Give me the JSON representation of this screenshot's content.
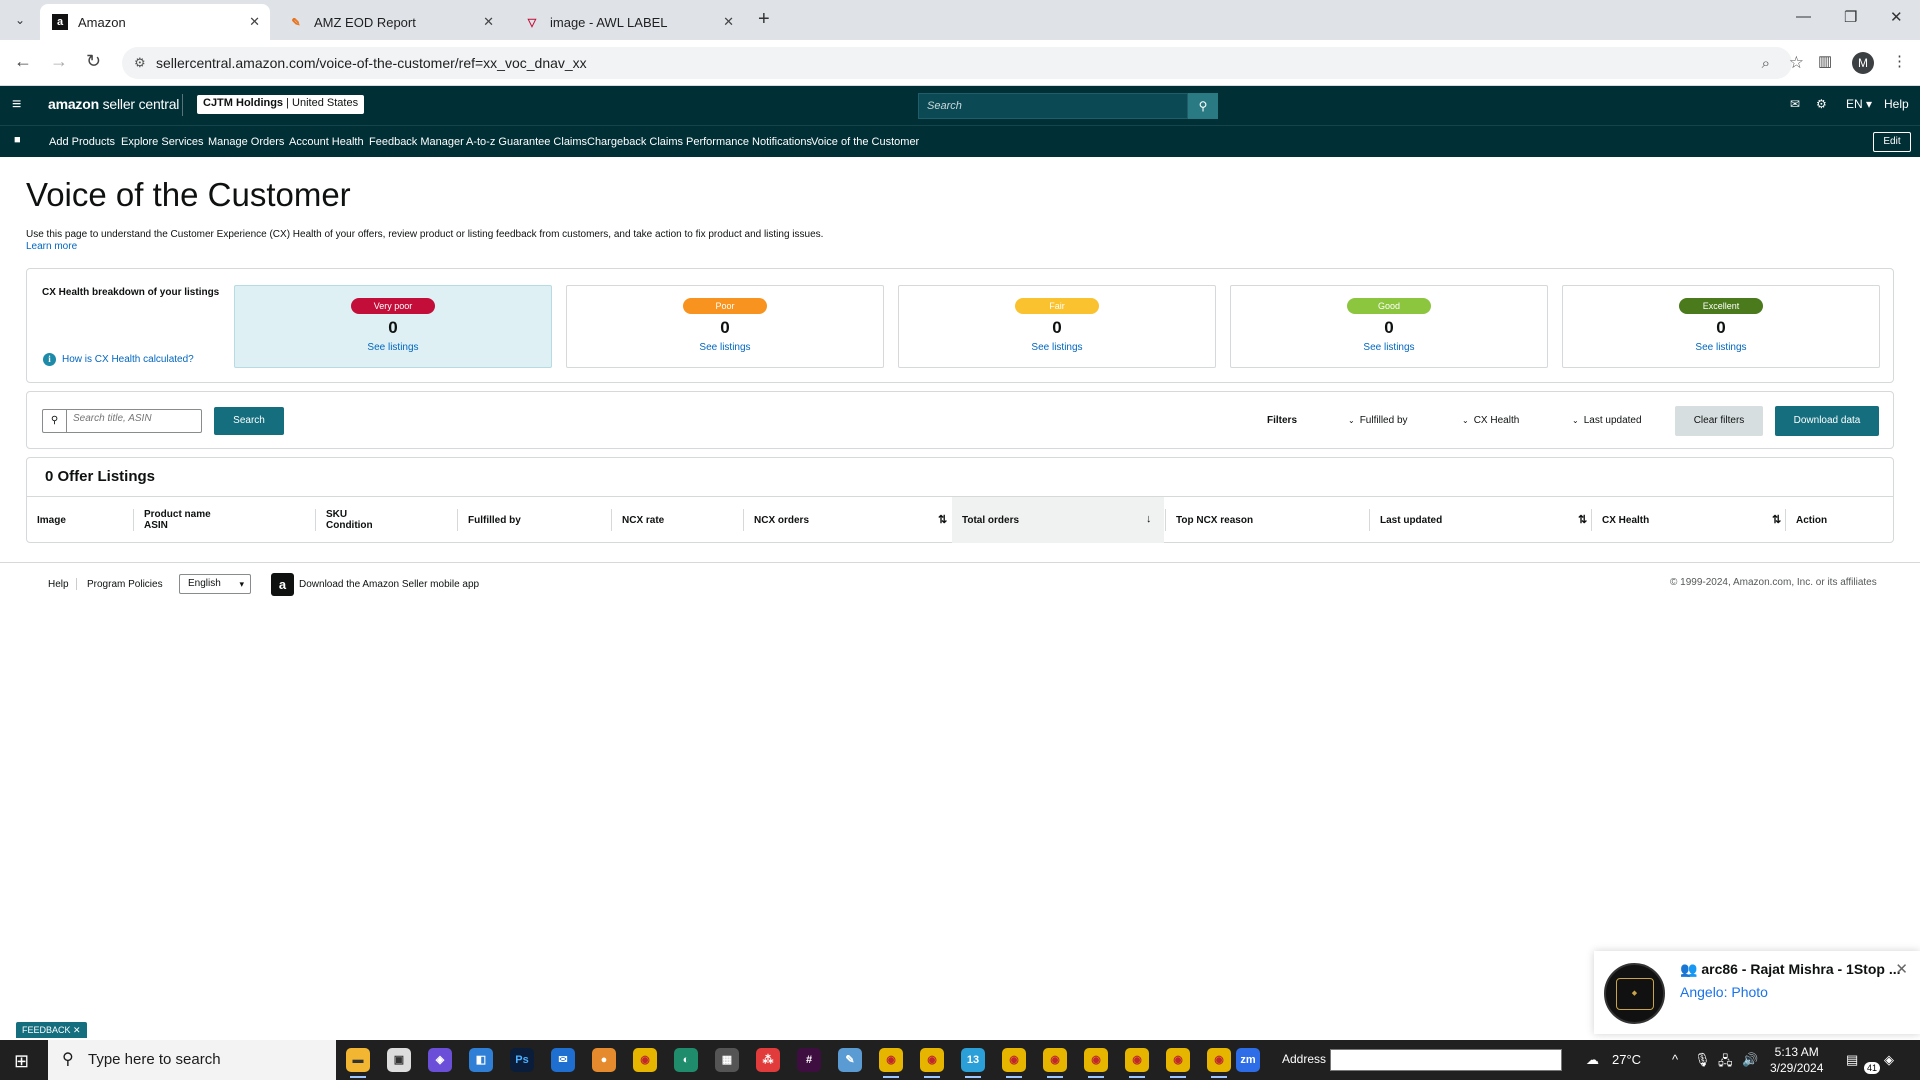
{
  "browser": {
    "tabs": [
      {
        "title": "Amazon",
        "favicon": "a",
        "active": true
      },
      {
        "title": "AMZ EOD Report",
        "favicon": "✎",
        "active": false
      },
      {
        "title": "image - AWL LABEL",
        "favicon": "▽",
        "active": false
      }
    ],
    "url": "sellercentral.amazon.com/voice-of-the-customer/ref=xx_voc_dnav_xx",
    "profile_initial": "M"
  },
  "header": {
    "logo_bold": "amazon",
    "logo_light": " seller central",
    "account_name": "CJTM Holdings",
    "account_region": "United States",
    "search_placeholder": "Search",
    "language": "EN",
    "help": "Help"
  },
  "nav": {
    "items": [
      "Add Products",
      "Explore Services",
      "Manage Orders",
      "Account Health",
      "Feedback Manager",
      "A-to-z Guarantee Claims",
      "Chargeback Claims",
      "Performance Notifications",
      "Voice of the Customer"
    ],
    "edit_label": "Edit"
  },
  "page": {
    "title": "Voice of the Customer",
    "description": "Use this page to understand the Customer Experience (CX) Health of your offers, review product or listing feedback from customers, and take action to fix product and listing issues.",
    "learn_more": "Learn more"
  },
  "cx_health": {
    "heading": "CX Health breakdown of your listings",
    "info_link": "How is CX Health calculated?",
    "cards": [
      {
        "label": "Very poor",
        "count": "0",
        "link": "See listings",
        "color": "#c40e3a"
      },
      {
        "label": "Poor",
        "count": "0",
        "link": "See listings",
        "color": "#f7931e"
      },
      {
        "label": "Fair",
        "count": "0",
        "link": "See listings",
        "color": "#f9c22e"
      },
      {
        "label": "Good",
        "count": "0",
        "link": "See listings",
        "color": "#8cc63f"
      },
      {
        "label": "Excellent",
        "count": "0",
        "link": "See listings",
        "color": "#4a7a1b"
      }
    ]
  },
  "filters": {
    "search_placeholder": "Search title, ASIN",
    "search_button": "Search",
    "filters_label": "Filters",
    "dropdowns": [
      "Fulfilled by",
      "CX Health",
      "Last updated"
    ],
    "clear_button": "Clear filters",
    "download_button": "Download data"
  },
  "listings": {
    "title": "0 Offer Listings",
    "columns": {
      "image": "Image",
      "product_name": "Product name",
      "asin": "ASIN",
      "sku": "SKU",
      "condition": "Condition",
      "fulfilled_by": "Fulfilled by",
      "ncx_rate": "NCX rate",
      "ncx_orders": "NCX orders",
      "total_orders": "Total orders",
      "top_ncx_reason": "Top NCX reason",
      "last_updated": "Last updated",
      "cx_health": "CX Health",
      "action": "Action"
    }
  },
  "footer": {
    "help": "Help",
    "program_policies": "Program Policies",
    "language": "English",
    "app_download": "Download the Amazon Seller mobile app",
    "copyright": "© 1999-2024, Amazon.com, Inc. or its affiliates"
  },
  "feedback": "FEEDBACK",
  "notification": {
    "title": "arc86 - Rajat Mishra - 1Stop ...",
    "subtitle": "Angelo: Photo"
  },
  "taskbar": {
    "search_placeholder": "Type here to search",
    "address_label": "Address",
    "temperature": "27°C",
    "time": "5:13 AM",
    "date": "3/29/2024",
    "notification_count": "41",
    "telegram_badge": "13"
  }
}
